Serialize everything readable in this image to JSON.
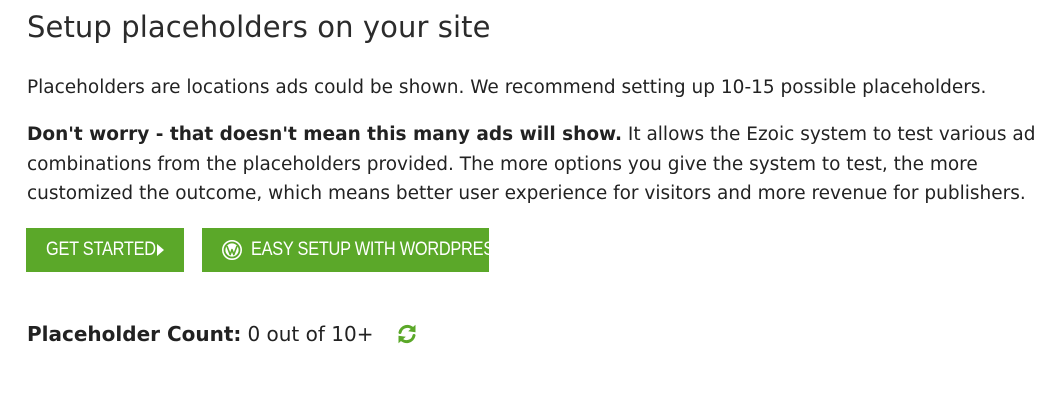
{
  "header": {
    "title": "Setup placeholders on your site"
  },
  "intro": {
    "text": "Placeholders are locations ads could be shown. We recommend setting up 10-15 possible placeholders."
  },
  "note": {
    "bold": "Don't worry - that doesn't mean this many ads will show.",
    "text": " It allows the Ezoic system to test various ad combinations from the placeholders provided. The more options you give the system to test, the more customized the outcome, which means better user experience for visitors and more revenue for publishers."
  },
  "buttons": {
    "get_started": "GET STARTED",
    "wordpress": "EASY SETUP WITH WORDPRESS"
  },
  "count": {
    "label": "Placeholder Count:",
    "value": "0 out of 10+"
  },
  "colors": {
    "accent": "#5ba829",
    "text": "#222222"
  },
  "icons": {
    "start": "caret-right-icon",
    "wordpress": "wordpress-icon",
    "refresh": "refresh-icon"
  }
}
